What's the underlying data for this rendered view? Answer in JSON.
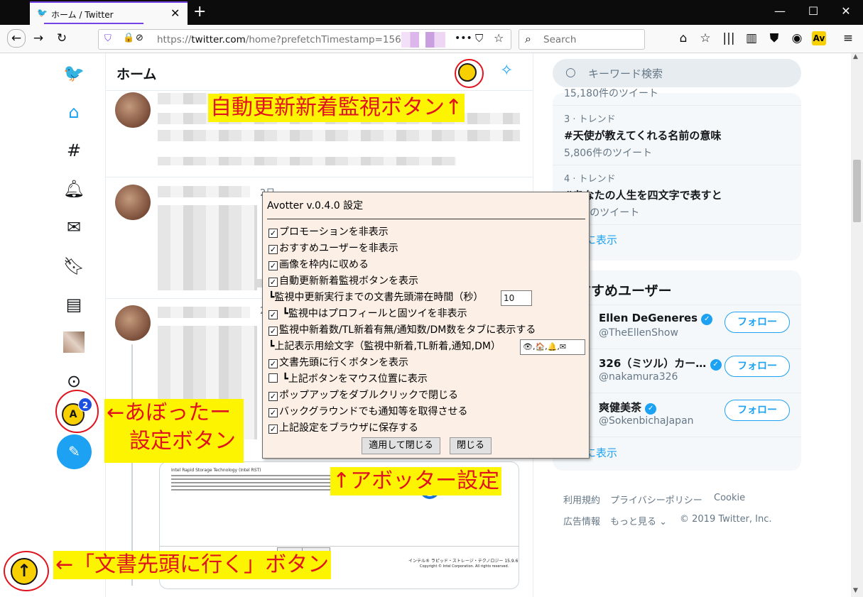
{
  "browser": {
    "tab_title": "ホーム / Twitter",
    "tab_icon": "twitter-bird-icon",
    "url_domain": "twitter.com",
    "url_path": "/home?prefetchTimestamp=156",
    "search_placeholder": "Search",
    "ext_label": "Av"
  },
  "nav": {
    "items": [
      "twitter-logo",
      "home",
      "explore",
      "notifications",
      "messages",
      "bookmarks",
      "lists",
      "profile",
      "more"
    ]
  },
  "main": {
    "title": "ホーム",
    "tweet_time": "2日",
    "tweet_time2": "2"
  },
  "annotations": {
    "watch_button": "自動更新新着監視ボタン↑",
    "settings_button_line1": "←あぼったー",
    "settings_button_line2": "設定ボタン",
    "avotter_settings": "↑アボッター設定",
    "go_top_button": "←「文書先頭に行く」ボタン"
  },
  "right": {
    "search_placeholder": "キーワード検索",
    "trend_partial_count": "15,180件のツイート",
    "trends": [
      {
        "meta": "3 · トレンド",
        "name": "#天使が教えてくれる名前の意味",
        "count": "5,806件のツイート"
      },
      {
        "meta": "4 · トレンド",
        "name": "#あなたの人生を四文字で表すと",
        "count": "2,2件のツイート"
      }
    ],
    "show_more": "さらに表示",
    "who_title": "おすすめユーザー",
    "who": [
      {
        "name": "Ellen DeGeneres",
        "handle": "@TheEllenShow",
        "follow": "フォロー"
      },
      {
        "name": "326（ミツル）カー…",
        "handle": "@nakamura326",
        "follow": "フォロー"
      },
      {
        "name": "爽健美茶",
        "handle": "@SokenbichaJapan",
        "follow": "フォロー"
      }
    ],
    "footer": {
      "terms": "利用規約",
      "privacy": "プライバシーポリシー",
      "cookie": "Cookie",
      "ads": "広告情報",
      "more": "もっと見る",
      "copyright": "© 2019 Twitter, Inc."
    }
  },
  "dialog": {
    "title": "Avotter v.0.4.0 設定",
    "options": [
      {
        "label": "プロモーションを非表示",
        "checked": true
      },
      {
        "label": "おすすめユーザーを非表示",
        "checked": true
      },
      {
        "label": "画像を枠内に収める",
        "checked": true
      },
      {
        "label": "自動更新新着監視ボタンを表示",
        "checked": true
      },
      {
        "label": "┗監視中更新実行までの文書先頭滞在時間（秒）",
        "checked": null
      },
      {
        "label": " ┗監視中はプロフィールと固ツイを非表示",
        "checked": true
      },
      {
        "label": "監視中新着数/TL新着有無/通知数/DM数をタブに表示する",
        "checked": true
      },
      {
        "label": "┗上記表示用絵文字（監視中新着,TL新着,通知,DM）",
        "checked": null
      },
      {
        "label": "文書先頭に行くボタンを表示",
        "checked": true
      },
      {
        "label": " ┗上記ボタンをマウス位置に表示",
        "checked": false
      },
      {
        "label": "ポップアップをダブルクリックで閉じる",
        "checked": true
      },
      {
        "label": "バックグラウンドでも通知等を取得させる",
        "checked": true
      },
      {
        "label": "上記設定をブラウザに保存する",
        "checked": true
      }
    ],
    "dwell_seconds": "10",
    "emoji_value": "👁,🏠,🔔,✉",
    "apply_label": "適用して閉じる",
    "close_label": "閉じる"
  },
  "buttons": {
    "avotter_label": "A",
    "badge_count": "2",
    "top_label": "↑"
  },
  "embedded_image_text": "Intel Rapid Storage Technology (Intel RST)",
  "embedded_image_footer": "インテル® ラピッド・ストレージ・テクノロジー 15.9.6.1044",
  "embedded_image_copyright": "Copyright © Intel Corporation. All rights reserved."
}
